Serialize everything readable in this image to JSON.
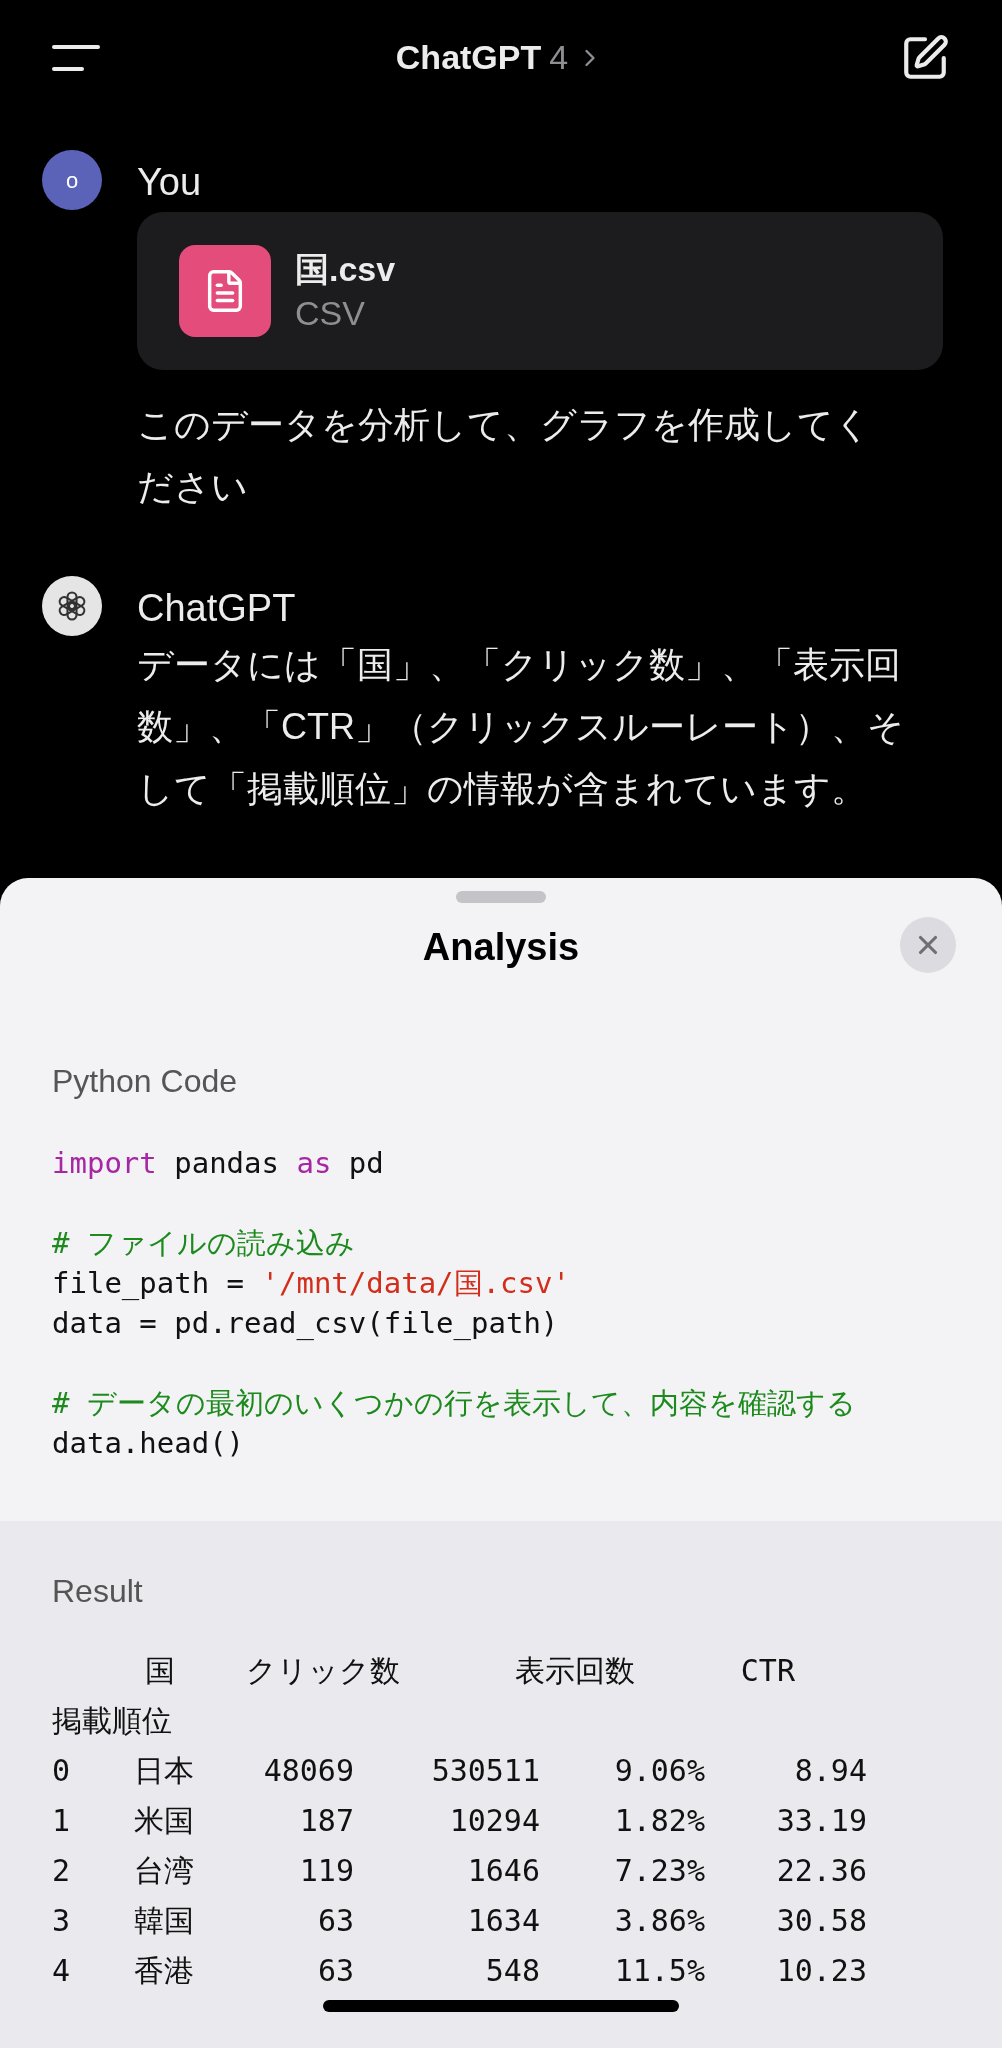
{
  "header": {
    "title": "ChatGPT",
    "model": "4"
  },
  "messages": [
    {
      "kind": "user",
      "author": "You",
      "avatar_letter": "o",
      "attachment": {
        "name": "国.csv",
        "type": "CSV"
      },
      "text": "このデータを分析して、グラフを作成してください"
    },
    {
      "kind": "assistant",
      "author": "ChatGPT",
      "text": "データには「国」、「クリック数」、「表示回数」、「CTR」（クリックスルーレート）、そして「掲載順位」の情報が含まれています。"
    }
  ],
  "sheet": {
    "title": "Analysis",
    "code_label": "Python Code",
    "code_lines": [
      {
        "kind": "code",
        "tokens": [
          {
            "kind": "keyword",
            "text": "import"
          },
          {
            "kind": "plain",
            "text": " pandas "
          },
          {
            "kind": "keyword",
            "text": "as"
          },
          {
            "kind": "plain",
            "text": " pd"
          }
        ]
      },
      {
        "kind": "blank"
      },
      {
        "kind": "code",
        "tokens": [
          {
            "kind": "comment",
            "text": "# ファイルの読み込み"
          }
        ]
      },
      {
        "kind": "code",
        "tokens": [
          {
            "kind": "plain",
            "text": "file_path = "
          },
          {
            "kind": "string",
            "text": "'/mnt/data/国.csv'"
          }
        ]
      },
      {
        "kind": "code",
        "tokens": [
          {
            "kind": "plain",
            "text": "data = pd.read_csv(file_path)"
          }
        ]
      },
      {
        "kind": "blank"
      },
      {
        "kind": "code",
        "tokens": [
          {
            "kind": "comment",
            "text": "# データの最初のいくつかの行を表示して、内容を確認する"
          }
        ]
      },
      {
        "kind": "code",
        "tokens": [
          {
            "kind": "plain",
            "text": "data.head()"
          }
        ]
      }
    ],
    "result_label": "Result",
    "result_table": {
      "columns": [
        "",
        "国",
        "クリック数",
        "表示回数",
        "CTR"
      ],
      "overflow_column": "掲載順位",
      "rows": [
        [
          "0",
          "日本",
          "48069",
          "530511",
          "9.06%",
          "8.94"
        ],
        [
          "1",
          "米国",
          "187",
          "10294",
          "1.82%",
          "33.19"
        ],
        [
          "2",
          "台湾",
          "119",
          "1646",
          "7.23%",
          "22.36"
        ],
        [
          "3",
          "韓国",
          "63",
          "1634",
          "3.86%",
          "30.58"
        ],
        [
          "4",
          "香港",
          "63",
          "548",
          "11.5%",
          "10.23"
        ]
      ]
    }
  }
}
